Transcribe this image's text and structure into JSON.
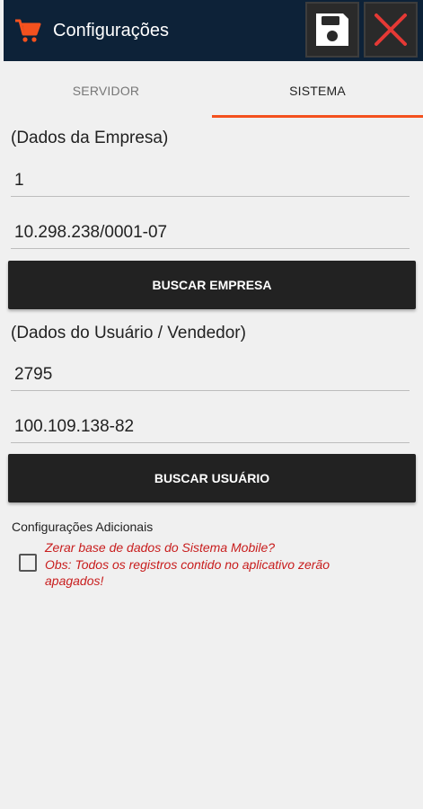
{
  "appbar": {
    "title": "Configurações",
    "icons": {
      "leading": "cart-icon",
      "save": "floppy-disk-icon",
      "close": "close-x-icon"
    },
    "colors": {
      "background": "#0d2238",
      "accent": "#f4511e",
      "close_icon": "#e53935"
    }
  },
  "tabs": [
    {
      "label": "SERVIDOR",
      "active": false
    },
    {
      "label": "SISTEMA",
      "active": true
    }
  ],
  "empresa": {
    "section_label": "(Dados da Empresa)",
    "codigo_value": "1",
    "cnpj_value": "10.298.238/0001-07",
    "button_label": "BUSCAR EMPRESA"
  },
  "usuario": {
    "section_label": "(Dados do Usuário / Vendedor)",
    "codigo_value": "2795",
    "cpf_value": "100.109.138-82",
    "button_label": "BUSCAR USUÁRIO"
  },
  "adicionais": {
    "section_label": "Configurações Adicionais",
    "checkbox_checked": false,
    "question_text": "Zerar base de dados do Sistema Mobile?",
    "obs_line1": " Obs: Todos os registros contido no aplicativo zerão",
    "obs_line2": "apagados!",
    "warning_color": "#c81d1d"
  }
}
